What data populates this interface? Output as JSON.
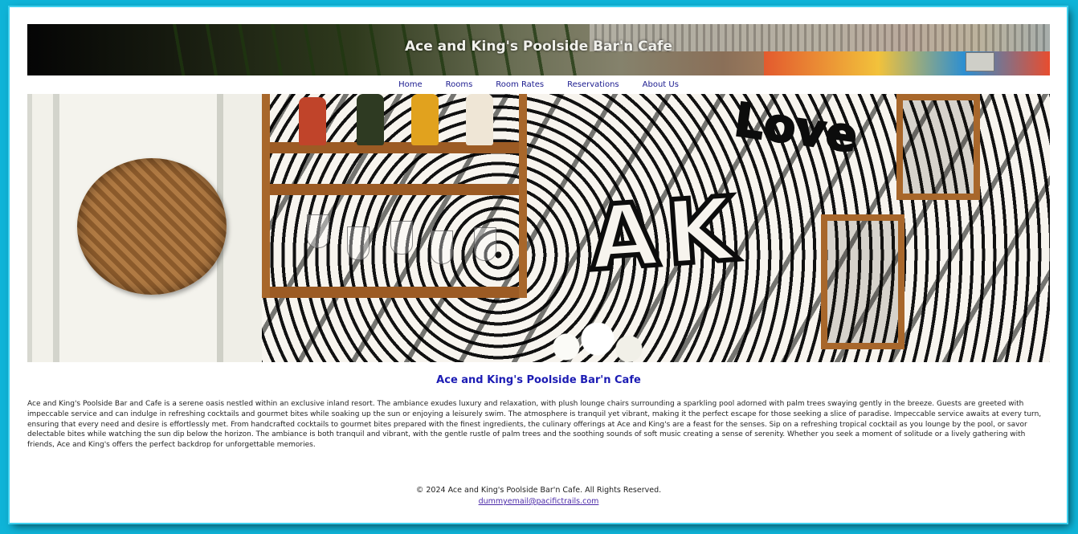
{
  "header": {
    "title": "Ace and King's Poolside Bar'n Cafe"
  },
  "nav": {
    "items": [
      {
        "label": "Home"
      },
      {
        "label": "Rooms"
      },
      {
        "label": "Room Rates"
      },
      {
        "label": "Reservations"
      },
      {
        "label": "About Us"
      }
    ]
  },
  "hero": {
    "mural_text_love": "Love",
    "mural_text_ak": "AK"
  },
  "main": {
    "heading": "Ace and King's Poolside Bar'n Cafe",
    "paragraph": "Ace and King's Poolside Bar and Cafe is a serene oasis nestled within an exclusive inland resort. The ambiance exudes luxury and relaxation, with plush lounge chairs surrounding a sparkling pool adorned with palm trees swaying gently in the breeze. Guests are greeted with impeccable service and can indulge in refreshing cocktails and gourmet bites while soaking up the sun or enjoying a leisurely swim. The atmosphere is tranquil yet vibrant, making it the perfect escape for those seeking a slice of paradise. Impeccable service awaits at every turn, ensuring that every need and desire is effortlessly met. From handcrafted cocktails to gourmet bites prepared with the finest ingredients, the culinary offerings at Ace and King's are a feast for the senses. Sip on a refreshing tropical cocktail as you lounge by the pool, or savor delectable bites while watching the sun dip below the horizon. The ambiance is both tranquil and vibrant, with the gentle rustle of palm trees and the soothing sounds of soft music creating a sense of serenity. Whether you seek a moment of solitude or a lively gathering with friends, Ace and King's offers the perfect backdrop for unforgettable memories."
  },
  "footer": {
    "copyright": "© 2024 Ace and King's Poolside Bar'n Cafe. All Rights Reserved.",
    "email": "dummyemail@pacifictrails.com"
  },
  "colors": {
    "page_background": "#0fb4d8",
    "nav_link": "#1b1b8f",
    "heading": "#1c1cb4",
    "footer_link": "#4b2aa8"
  }
}
